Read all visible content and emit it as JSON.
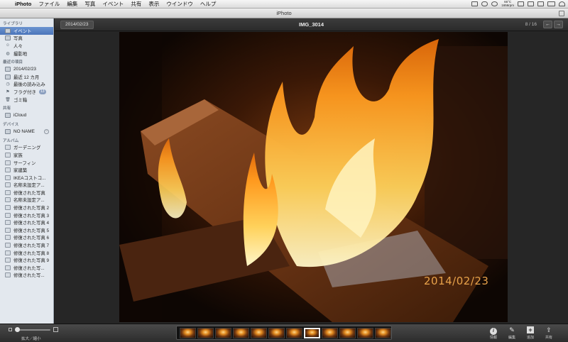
{
  "menubar": {
    "apple": "",
    "app_name": "iPhoto",
    "items": [
      "ファイル",
      "編集",
      "写真",
      "イベント",
      "共有",
      "表示",
      "ウインドウ",
      "ヘルプ"
    ],
    "temp_line1": "66°C",
    "temp_line2": "1656rpm"
  },
  "window": {
    "title": "iPhoto"
  },
  "sidebar": {
    "library": {
      "header": "ライブラリ",
      "items": [
        {
          "label": "イベント",
          "icon": "events-icon"
        },
        {
          "label": "写真",
          "icon": "photos-icon"
        },
        {
          "label": "人々",
          "icon": "faces-icon"
        },
        {
          "label": "撮影地",
          "icon": "places-icon"
        }
      ]
    },
    "recent": {
      "header": "最近の項目",
      "items": [
        {
          "label": "2014/02/23",
          "icon": "event-icon"
        },
        {
          "label": "最近 12 カ月",
          "icon": "calendar-icon"
        },
        {
          "label": "最後の読み込み",
          "icon": "clock-icon"
        },
        {
          "label": "フラグ付き",
          "icon": "flag-icon",
          "badge": "13"
        },
        {
          "label": "ゴミ箱",
          "icon": "trash-icon"
        }
      ]
    },
    "shared": {
      "header": "共有",
      "items": [
        {
          "label": "iCloud",
          "icon": "cloud-icon"
        }
      ]
    },
    "devices": {
      "header": "デバイス",
      "items": [
        {
          "label": "NO NAME",
          "icon": "drive-icon"
        }
      ]
    },
    "albums": {
      "header": "アルバム",
      "items": [
        {
          "label": "ガーデニング",
          "icon": "smart-album-icon"
        },
        {
          "label": "家族",
          "icon": "smart-album-icon"
        },
        {
          "label": "サーフィン",
          "icon": "smart-album-icon"
        },
        {
          "label": "家建築",
          "icon": "smart-album-icon"
        },
        {
          "label": "IKEAコストコ...",
          "icon": "smart-album-icon"
        },
        {
          "label": "名称未設定ア...",
          "icon": "album-icon"
        },
        {
          "label": "修復された写真",
          "icon": "album-icon"
        },
        {
          "label": "名称未設定ア...",
          "icon": "album-icon"
        },
        {
          "label": "修復された写真 2",
          "icon": "album-icon"
        },
        {
          "label": "修復された写真 3",
          "icon": "album-icon"
        },
        {
          "label": "修復された写真 4",
          "icon": "album-icon"
        },
        {
          "label": "修復された写真 5",
          "icon": "album-icon"
        },
        {
          "label": "修復された写真 6",
          "icon": "album-icon"
        },
        {
          "label": "修復された写真 7",
          "icon": "album-icon"
        },
        {
          "label": "修復された写真 8",
          "icon": "album-icon"
        },
        {
          "label": "修復された写真 9",
          "icon": "album-icon"
        },
        {
          "label": "修復された写...",
          "icon": "album-icon"
        },
        {
          "label": "修復された写...",
          "icon": "album-icon"
        }
      ]
    }
  },
  "viewer": {
    "event_date": "2014/02/23",
    "image_title": "IMG_3014",
    "counter": "8 / 16",
    "prev_label": "←",
    "next_label": "→",
    "photo_date_stamp": "2014/02/23"
  },
  "toolbar": {
    "zoom_label": "拡大／縮小",
    "thumbnail_count": 12,
    "current_thumbnail": 8,
    "zoom_level": 0,
    "tools": [
      {
        "label": "情報",
        "icon": "info-icon"
      },
      {
        "label": "編集",
        "icon": "edit-pencil-icon"
      },
      {
        "label": "追加",
        "icon": "add-icon"
      },
      {
        "label": "共有",
        "icon": "share-icon"
      }
    ]
  }
}
